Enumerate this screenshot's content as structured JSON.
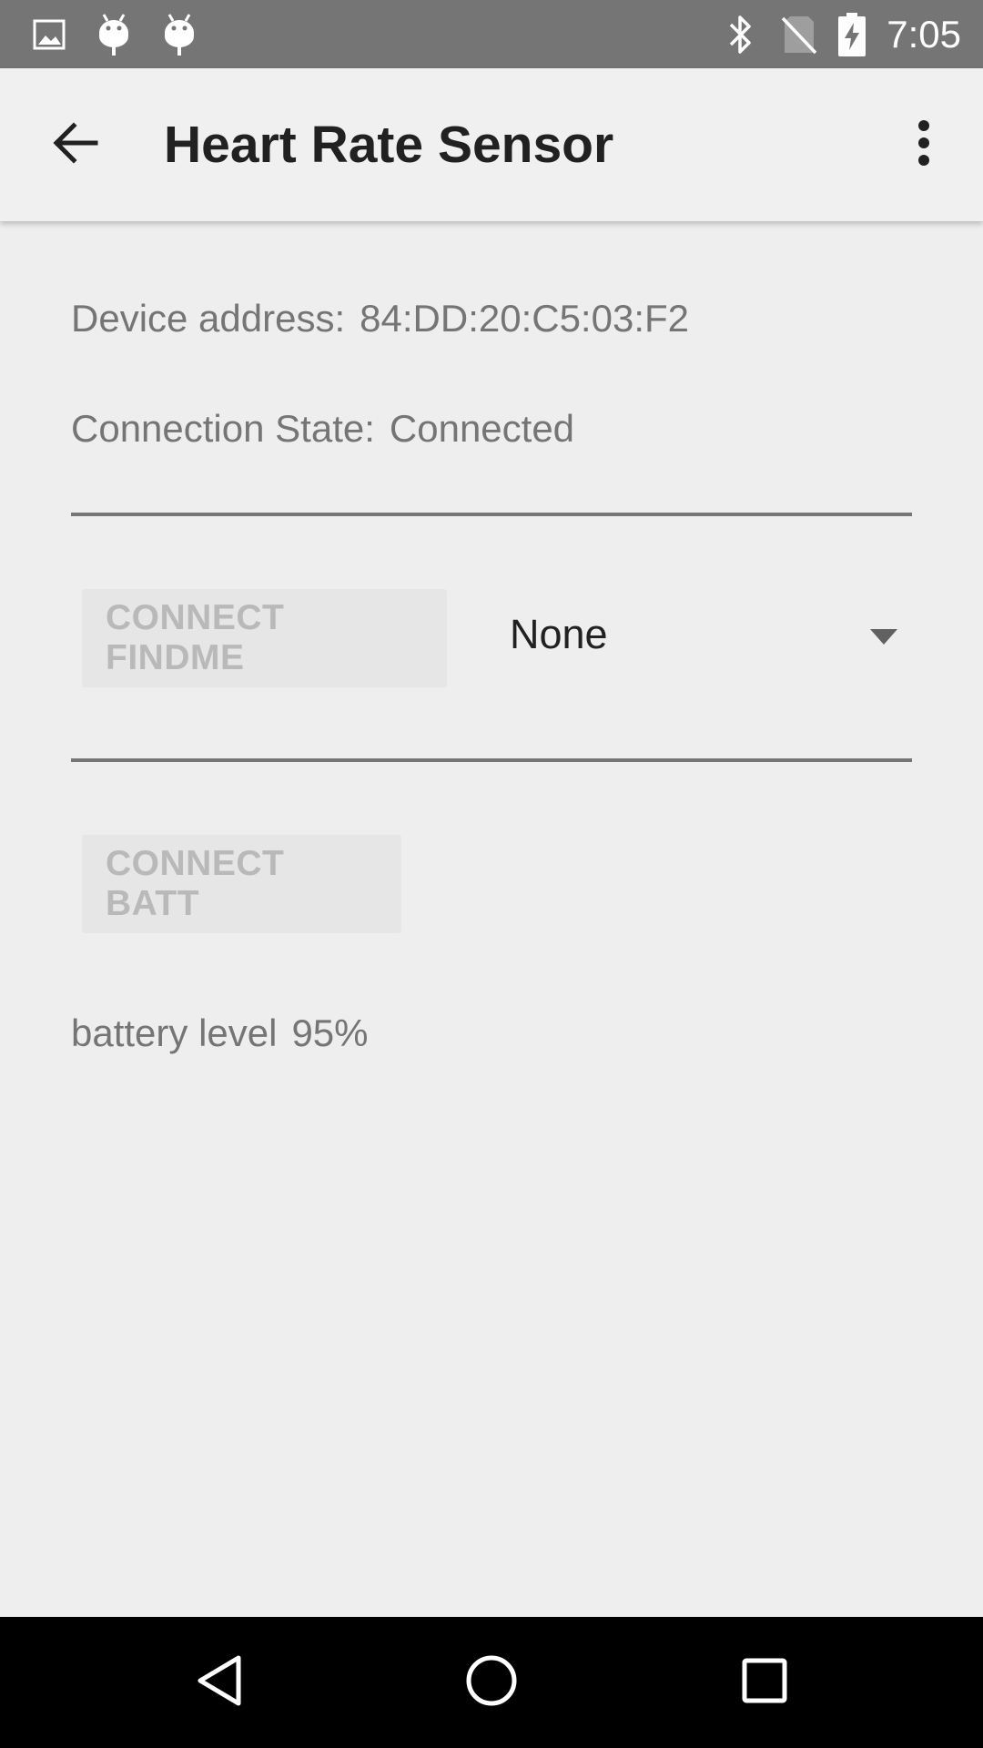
{
  "status_bar": {
    "time": "7:05",
    "left_icons": [
      "image-icon",
      "android-icon",
      "android-icon"
    ],
    "right_icons": [
      "bluetooth-icon",
      "no-sim-icon",
      "battery-charging-icon"
    ],
    "background": "#757575"
  },
  "app_bar": {
    "title": "Heart Rate Sensor",
    "back_icon": "arrow-back-icon",
    "menu_icon": "more-vert-icon"
  },
  "device": {
    "address_label": "Device address:",
    "address_value": "84:DD:20:C5:03:F2",
    "state_label": "Connection State:",
    "state_value": "Connected"
  },
  "findme": {
    "button_label": "CONNECT FINDME",
    "spinner_selected": "None"
  },
  "battery": {
    "button_label": "CONNECT BATT",
    "level_label": "battery level",
    "level_value": "95%"
  },
  "nav_bar": {
    "back_icon": "nav-back-icon",
    "home_icon": "nav-home-icon",
    "recents_icon": "nav-recents-icon"
  }
}
